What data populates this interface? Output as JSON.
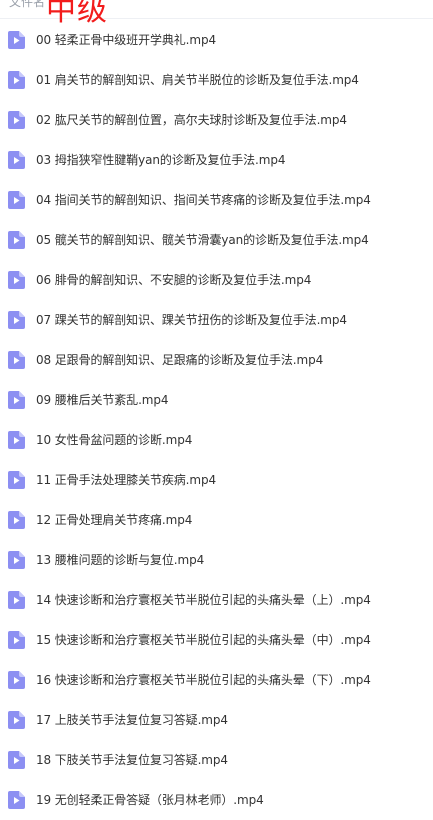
{
  "header": {
    "column_label": "文件名",
    "overlay_title": "中级"
  },
  "colors": {
    "icon": "#8c8ff2",
    "icon_fold": "#c6c8fb",
    "overlay_title": "#f21c1c",
    "text": "#333333"
  },
  "file_icon_name": "video-file-icon",
  "files": [
    {
      "name": "00 轻柔正骨中级班开学典礼.mp4"
    },
    {
      "name": "01 肩关节的解剖知识、肩关节半脱位的诊断及复位手法.mp4"
    },
    {
      "name": "02 肱尺关节的解剖位置，高尔夫球肘诊断及复位手法.mp4"
    },
    {
      "name": "03 拇指狭窄性腱鞘yan的诊断及复位手法.mp4"
    },
    {
      "name": "04 指间关节的解剖知识、指间关节疼痛的诊断及复位手法.mp4"
    },
    {
      "name": "05 髋关节的解剖知识、髋关节滑囊yan的诊断及复位手法.mp4"
    },
    {
      "name": "06 腓骨的解剖知识、不安腿的诊断及复位手法.mp4"
    },
    {
      "name": "07 踝关节的解剖知识、踝关节扭伤的诊断及复位手法.mp4"
    },
    {
      "name": "08 足跟骨的解剖知识、足跟痛的诊断及复位手法.mp4"
    },
    {
      "name": "09 腰椎后关节紊乱.mp4"
    },
    {
      "name": "10 女性骨盆问题的诊断.mp4"
    },
    {
      "name": "11 正骨手法处理膝关节疾病.mp4"
    },
    {
      "name": "12 正骨处理肩关节疼痛.mp4"
    },
    {
      "name": "13 腰椎问题的诊断与复位.mp4"
    },
    {
      "name": "14 快速诊断和治疗寰枢关节半脱位引起的头痛头晕（上）.mp4"
    },
    {
      "name": "15 快速诊断和治疗寰枢关节半脱位引起的头痛头晕（中）.mp4"
    },
    {
      "name": "16 快速诊断和治疗寰枢关节半脱位引起的头痛头晕（下）.mp4"
    },
    {
      "name": "17 上肢关节手法复位复习答疑.mp4"
    },
    {
      "name": "18 下肢关节手法复位复习答疑.mp4"
    },
    {
      "name": "19 无创轻柔正骨答疑（张月林老师）.mp4"
    }
  ]
}
